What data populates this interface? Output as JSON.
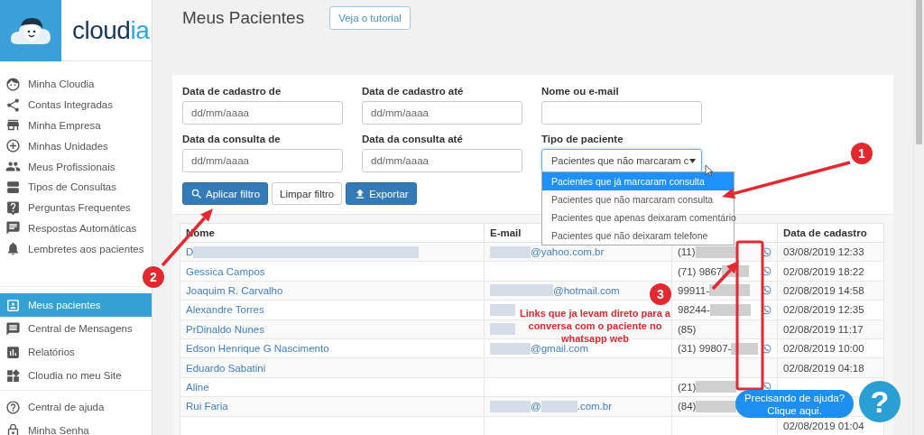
{
  "logo": {
    "text_main": "cloud",
    "text_accent": "ia"
  },
  "sidebar": {
    "groups": [
      [
        {
          "label": "Minha Cloudia",
          "selected": false
        },
        {
          "label": "Contas Integradas",
          "selected": false
        },
        {
          "label": "Minha Empresa",
          "selected": false
        },
        {
          "label": "Minhas Unidades",
          "selected": false
        },
        {
          "label": "Meus Profissionais",
          "selected": false
        },
        {
          "label": "Tipos de Consultas",
          "selected": false
        },
        {
          "label": "Perguntas Frequentes",
          "selected": false
        },
        {
          "label": "Respostas Automáticas",
          "selected": false
        },
        {
          "label": "Lembretes aos pacientes",
          "selected": false
        }
      ],
      [
        {
          "label": "Meus pacientes",
          "selected": true
        },
        {
          "label": "Central de Mensagens",
          "selected": false
        },
        {
          "label": "Relatórios",
          "selected": false
        },
        {
          "label": "Cloudia no meu Site",
          "selected": false
        }
      ],
      [
        {
          "label": "Central de ajuda",
          "selected": false
        },
        {
          "label": "Minha Senha",
          "selected": false
        }
      ]
    ]
  },
  "header": {
    "title": "Meus Pacientes",
    "tutorial_button": "Veja o tutorial"
  },
  "filters": {
    "fields": [
      {
        "label": "Data de cadastro de",
        "placeholder": "dd/mm/aaaa"
      },
      {
        "label": "Data de cadastro até",
        "placeholder": "dd/mm/aaaa"
      },
      {
        "label": "Nome ou e-mail"
      },
      {
        "label": "Data da consulta de",
        "placeholder": "dd/mm/aaaa"
      },
      {
        "label": "Data da consulta até",
        "placeholder": "dd/mm/aaaa"
      }
    ],
    "patient_type": {
      "label": "Tipo de paciente",
      "value": "Pacientes que não marcaram c",
      "expanded": true,
      "options": [
        {
          "label": "Pacientes que já marcaram consulta",
          "selected": true
        },
        {
          "label": "Pacientes que não marcaram consulta",
          "selected": false
        },
        {
          "label": "Pacientes que apenas deixaram comentário",
          "selected": false
        },
        {
          "label": "Pacientes que não deixaram telefone",
          "selected": false
        }
      ]
    },
    "buttons": [
      {
        "kind": "search",
        "label": "Aplicar filtro"
      },
      {
        "kind": "plain",
        "label": "Limpar filtro"
      },
      {
        "kind": "export",
        "label": "Exportar"
      }
    ]
  },
  "table": {
    "columns": [
      "Nome",
      "E-mail",
      "Data de cadastro"
    ],
    "rows": [
      {
        "name": [
          {
            "text": "D",
            "masked_after": true
          }
        ],
        "email": [
          {
            "text": "@yahoo.com.br",
            "masked_before": true
          }
        ],
        "phone": [
          {
            "text": "(11)",
            "masked_after": true
          }
        ],
        "whatsapp": true,
        "date": "03/08/2019 12:33"
      },
      {
        "name": [
          {
            "text": "Gessica Campos"
          }
        ],
        "phone": [
          {
            "text": "(71) 9867",
            "masked_after": true
          }
        ],
        "whatsapp": true,
        "date": "02/08/2019 18:22"
      },
      {
        "name": [
          {
            "text": "Joaquim R. Carvalho"
          }
        ],
        "email": [
          {
            "text": "@hotmail.com",
            "masked_before": true
          }
        ],
        "phone": [
          {
            "text": "99911-",
            "masked_after": true
          }
        ],
        "whatsapp": true,
        "date": "02/08/2019 14:58"
      },
      {
        "name": [
          {
            "text": "Alexandre Torres"
          }
        ],
        "email": [
          {
            "masked": true
          }
        ],
        "phone": [
          {
            "text": "98244-",
            "masked_after": true
          }
        ],
        "whatsapp": true,
        "date": "02/08/2019 12:35"
      },
      {
        "name": [
          {
            "text": "PrDinaldo Nunes"
          }
        ],
        "email": [
          {
            "masked": true
          }
        ],
        "phone": [
          {
            "text": "(85)"
          }
        ],
        "whatsapp": false,
        "date": "02/08/2019 11:17"
      },
      {
        "name": [
          {
            "text": "Edson Henrique G Nascimento"
          }
        ],
        "email": [
          {
            "text": "@gmail.com",
            "masked_before": true
          }
        ],
        "phone": [
          {
            "text": "(31) 99807-",
            "masked_after": true
          }
        ],
        "whatsapp": true,
        "date": "02/08/2019 10:00"
      },
      {
        "name": [
          {
            "text": "Eduardo Sabatini"
          }
        ],
        "whatsapp": false,
        "date": "02/08/2019 04:18"
      },
      {
        "name": [
          {
            "text": "Aline"
          }
        ],
        "phone": [
          {
            "text": "(21)",
            "masked_after": true
          }
        ],
        "whatsapp": true
      },
      {
        "name": [
          {
            "text": "Rui Faria"
          }
        ],
        "email": [
          {
            "text": "@",
            "masked_before": true,
            "masked_after": true
          },
          {
            "text": ".com.br"
          }
        ],
        "phone": [
          {
            "text": "(84)",
            "masked_after": true
          }
        ],
        "whatsapp": false
      },
      {
        "whatsapp": false,
        "date": "02/08/2019 01:04"
      }
    ]
  },
  "annotations": {
    "badges": [
      "1",
      "2",
      "3"
    ],
    "note": "Links que ja levam direto para a conversa com o paciente no whatsapp web"
  },
  "help": {
    "lines": [
      "Precisando de ajuda?",
      "Clique aqui."
    ],
    "icon_text": "?"
  }
}
